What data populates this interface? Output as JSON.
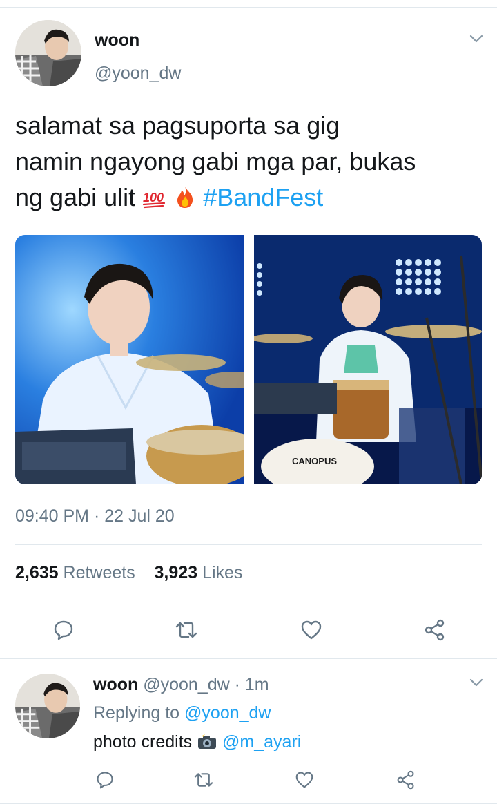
{
  "tweet": {
    "display_name": "woon",
    "handle": "@yoon_dw",
    "text_lines": [
      "salamat sa pagsuporta sa gig",
      "namin ngayong gabi mga par, bukas",
      "ng gabi ulit"
    ],
    "emoji_1": "hundred-points-emoji",
    "emoji_2": "fire-emoji",
    "hashtag": "#BandFest",
    "photo_right_logo": "CANOPUS",
    "timestamp": "09:40 PM · 22 Jul 20",
    "retweet_count": "2,635",
    "retweet_label": "Retweets",
    "like_count": "3,923",
    "like_label": "Likes",
    "actions": [
      "reply-icon",
      "retweet-icon",
      "like-icon",
      "share-icon"
    ]
  },
  "reply": {
    "display_name": "woon",
    "handle": "@yoon_dw",
    "separator": "·",
    "time": "1m",
    "replying_label": "Replying to",
    "replying_handle": "@yoon_dw",
    "body": "photo credits",
    "body_emoji": "camera-with-flash-emoji",
    "mention": "@m_ayari",
    "actions": [
      "reply-icon",
      "retweet-icon",
      "like-icon",
      "share-icon"
    ]
  },
  "colors": {
    "accent": "#1da1f2",
    "secondary_text": "#657786",
    "divider": "#e1e8ed",
    "icon": "#657786"
  }
}
